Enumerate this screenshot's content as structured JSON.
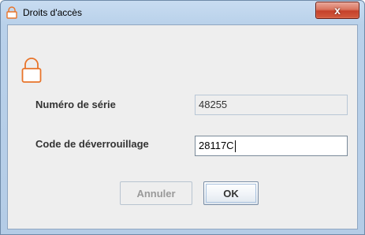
{
  "window": {
    "title": "Droits d'accès",
    "title_icon": "lock-icon",
    "close_label": "x"
  },
  "dialog": {
    "icon": "lock-icon",
    "serial_label": "Numéro de série",
    "serial_value": "48255",
    "unlock_label": "Code de déverrouillage",
    "unlock_value": "28117C",
    "cancel_label": "Annuler",
    "ok_label": "OK"
  },
  "colors": {
    "lock_orange": "#e8742a",
    "close_red": "#c5412a",
    "frame_blue": "#b9d1ea",
    "client_gray": "#eeeeee"
  }
}
